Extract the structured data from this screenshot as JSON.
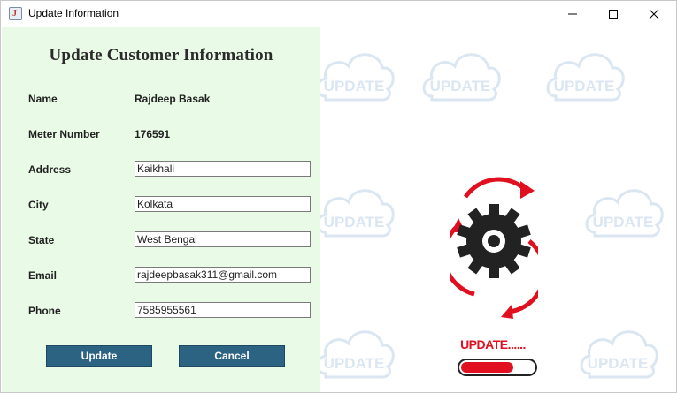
{
  "window": {
    "title": "Update Information",
    "app_icon": "java-cup-icon"
  },
  "form": {
    "heading": "Update Customer Information",
    "name": {
      "label": "Name",
      "value": "Rajdeep Basak"
    },
    "meter": {
      "label": "Meter Number",
      "value": "176591"
    },
    "address": {
      "label": "Address",
      "value": "Kaikhali"
    },
    "city": {
      "label": "City",
      "value": "Kolkata"
    },
    "state": {
      "label": "State",
      "value": "West Bengal"
    },
    "email": {
      "label": "Email",
      "value": "rajdeepbasak311@gmail.com"
    },
    "phone": {
      "label": "Phone",
      "value": "7585955561"
    },
    "update_label": "Update",
    "cancel_label": "Cancel"
  },
  "illustration": {
    "watermark_text": "UPDATE",
    "status_text": "UPDATE......",
    "progress": 0.72,
    "colors": {
      "accent": "#e01020",
      "gear": "#222222",
      "button": "#2c6382",
      "panel": "#e9fbe6",
      "watermark": "#5a8fc4"
    }
  }
}
